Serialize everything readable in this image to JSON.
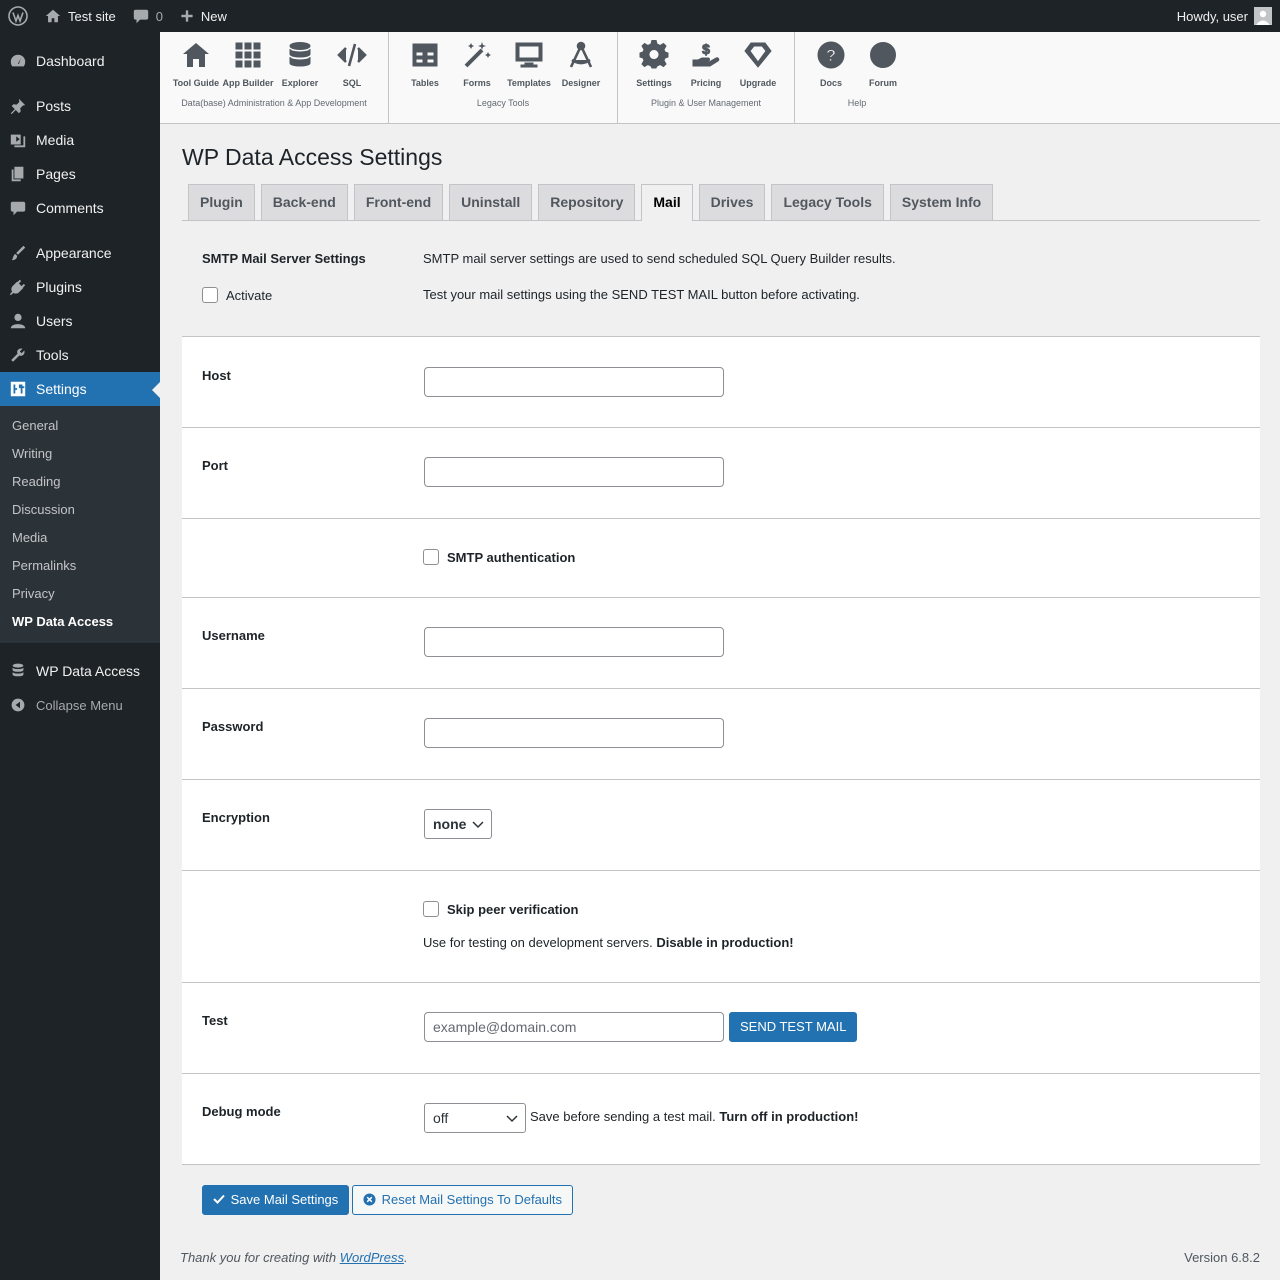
{
  "adminbar": {
    "site_name": "Test site",
    "comments_count": "0",
    "new_label": "New",
    "howdy": "Howdy, user"
  },
  "sidebar": {
    "items": [
      {
        "label": "Dashboard"
      },
      {
        "label": "Posts"
      },
      {
        "label": "Media"
      },
      {
        "label": "Pages"
      },
      {
        "label": "Comments"
      },
      {
        "label": "Appearance"
      },
      {
        "label": "Plugins"
      },
      {
        "label": "Users"
      },
      {
        "label": "Tools"
      },
      {
        "label": "Settings"
      }
    ],
    "submenu": [
      "General",
      "Writing",
      "Reading",
      "Discussion",
      "Media",
      "Permalinks",
      "Privacy",
      "WP Data Access"
    ],
    "wpda": "WP Data Access",
    "collapse": "Collapse Menu"
  },
  "toolbar": {
    "groups": [
      {
        "label": "Data(base) Administration & App Development",
        "buttons": [
          "Tool Guide",
          "App Builder",
          "Explorer",
          "SQL"
        ]
      },
      {
        "label": "Legacy Tools",
        "buttons": [
          "Tables",
          "Forms",
          "Templates",
          "Designer"
        ]
      },
      {
        "label": "Plugin & User Management",
        "buttons": [
          "Settings",
          "Pricing",
          "Upgrade"
        ]
      },
      {
        "label": "Help",
        "buttons": [
          "Docs",
          "Forum"
        ]
      }
    ]
  },
  "page": {
    "title": "WP Data Access Settings",
    "tabs": [
      "Plugin",
      "Back-end",
      "Front-end",
      "Uninstall",
      "Repository",
      "Mail",
      "Drives",
      "Legacy Tools",
      "System Info"
    ],
    "active_tab": "Mail"
  },
  "mail": {
    "smtp_heading": "SMTP Mail Server Settings",
    "smtp_desc": "SMTP mail server settings are used to send scheduled SQL Query Builder results.",
    "activate_label": "Activate",
    "activate_desc": "Test your mail settings using the SEND TEST MAIL button before activating.",
    "host_label": "Host",
    "port_label": "Port",
    "smtp_auth_label": "SMTP authentication",
    "username_label": "Username",
    "password_label": "Password",
    "encryption_label": "Encryption",
    "encryption_value": "none",
    "skip_peer_label": "Skip peer verification",
    "skip_peer_desc": "Use for testing on development servers.",
    "skip_peer_warn": "Disable in production!",
    "test_label": "Test",
    "test_placeholder": "example@domain.com",
    "send_test_button": "SEND TEST MAIL",
    "debug_label": "Debug mode",
    "debug_value": "off",
    "debug_desc": "Save before sending a test mail.",
    "debug_warn": "Turn off in production!",
    "save_button": "Save Mail Settings",
    "reset_button": "Reset Mail Settings To Defaults"
  },
  "footer": {
    "thanks_pre": "Thank you for creating with",
    "thanks_link": "WordPress",
    "thanks_post": ".",
    "version": "Version 6.8.2"
  }
}
